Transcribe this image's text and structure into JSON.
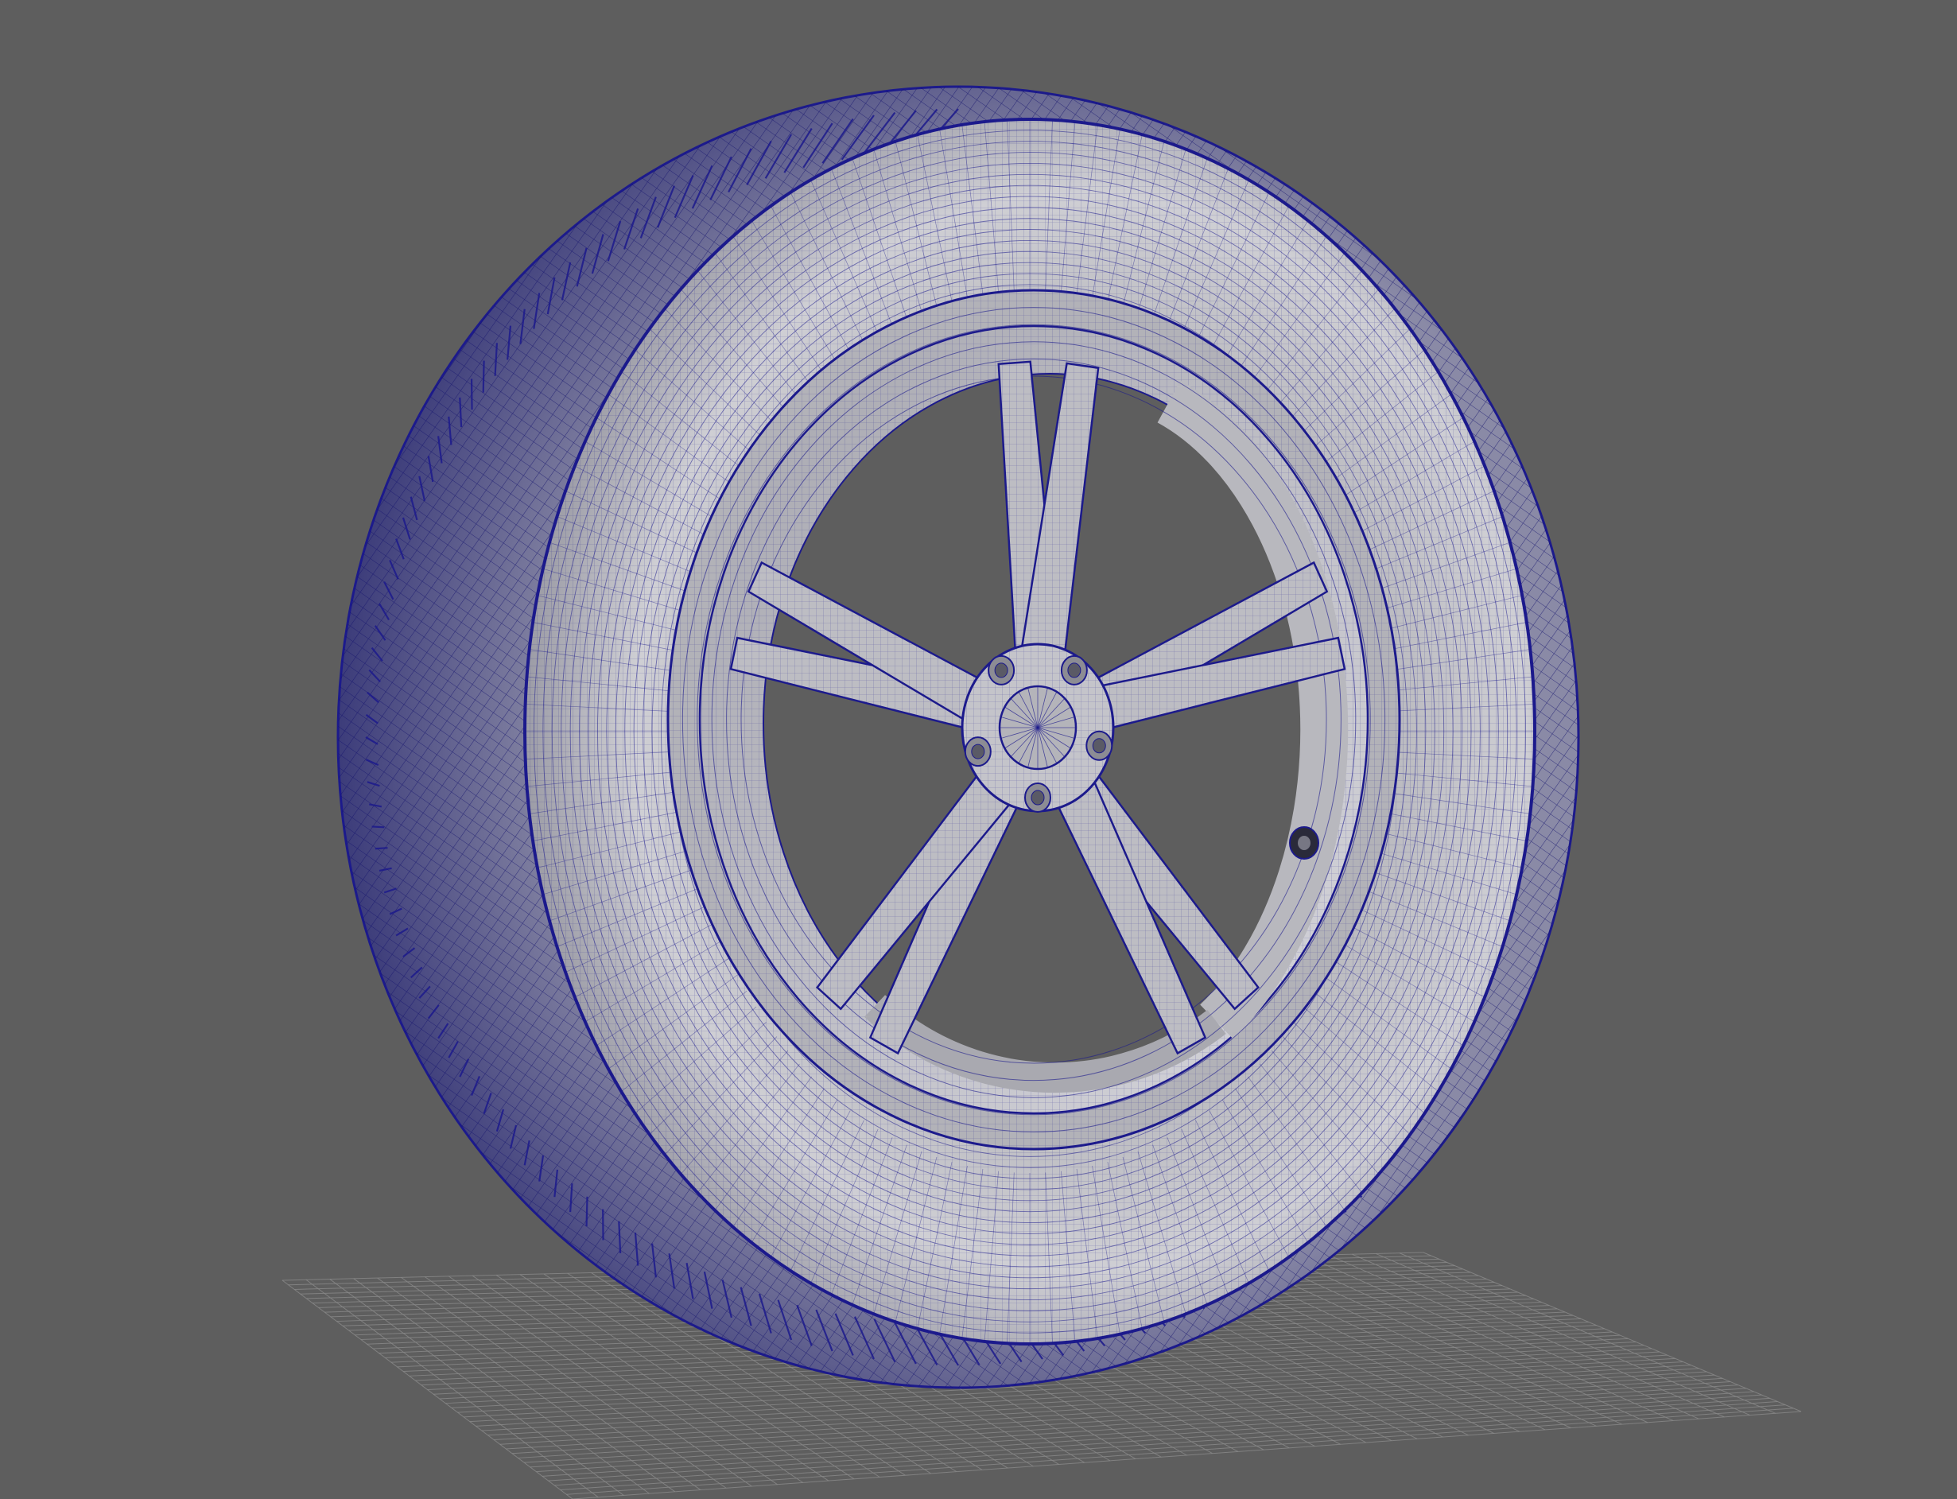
{
  "viewport": {
    "background": "#5e5e5e",
    "grid_color": "#8a8a8a",
    "grid_on": true,
    "display_mode": "wireframe-on-shaded"
  },
  "model": {
    "object": "wheel-with-tire",
    "spokes": 5,
    "spoke_style": "split-twin",
    "lug_nuts": 5,
    "valve_stem": true,
    "wire_color": "#1c1a8c",
    "surface_color": "#c2c2c6",
    "tread_color": "#55557a"
  }
}
